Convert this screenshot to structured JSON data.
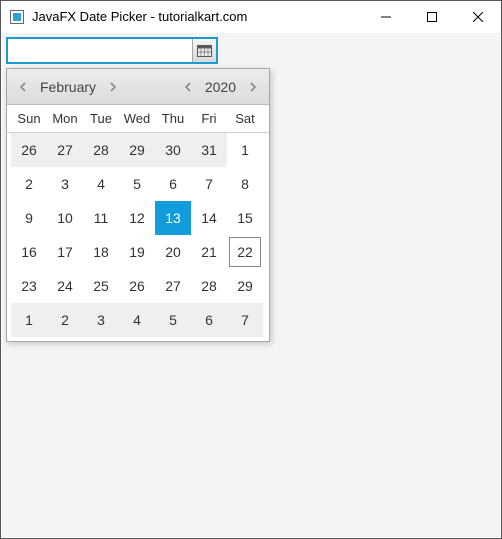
{
  "window": {
    "title": "JavaFX Date Picker - tutorialkart.com"
  },
  "dateField": {
    "value": "",
    "placeholder": ""
  },
  "picker": {
    "month": "February",
    "year": "2020",
    "daysOfWeek": [
      "Sun",
      "Mon",
      "Tue",
      "Wed",
      "Thu",
      "Fri",
      "Sat"
    ],
    "weeks": [
      [
        {
          "d": "26",
          "other": true
        },
        {
          "d": "27",
          "other": true
        },
        {
          "d": "28",
          "other": true
        },
        {
          "d": "29",
          "other": true
        },
        {
          "d": "30",
          "other": true
        },
        {
          "d": "31",
          "other": true
        },
        {
          "d": "1"
        }
      ],
      [
        {
          "d": "2"
        },
        {
          "d": "3"
        },
        {
          "d": "4"
        },
        {
          "d": "5"
        },
        {
          "d": "6"
        },
        {
          "d": "7"
        },
        {
          "d": "8"
        }
      ],
      [
        {
          "d": "9"
        },
        {
          "d": "10"
        },
        {
          "d": "11"
        },
        {
          "d": "12"
        },
        {
          "d": "13",
          "selected": true
        },
        {
          "d": "14"
        },
        {
          "d": "15"
        }
      ],
      [
        {
          "d": "16"
        },
        {
          "d": "17"
        },
        {
          "d": "18"
        },
        {
          "d": "19"
        },
        {
          "d": "20"
        },
        {
          "d": "21"
        },
        {
          "d": "22",
          "today": true
        }
      ],
      [
        {
          "d": "23"
        },
        {
          "d": "24"
        },
        {
          "d": "25"
        },
        {
          "d": "26"
        },
        {
          "d": "27"
        },
        {
          "d": "28"
        },
        {
          "d": "29"
        }
      ],
      [
        {
          "d": "1",
          "other": true
        },
        {
          "d": "2",
          "other": true
        },
        {
          "d": "3",
          "other": true
        },
        {
          "d": "4",
          "other": true
        },
        {
          "d": "5",
          "other": true
        },
        {
          "d": "6",
          "other": true
        },
        {
          "d": "7",
          "other": true
        }
      ]
    ]
  }
}
